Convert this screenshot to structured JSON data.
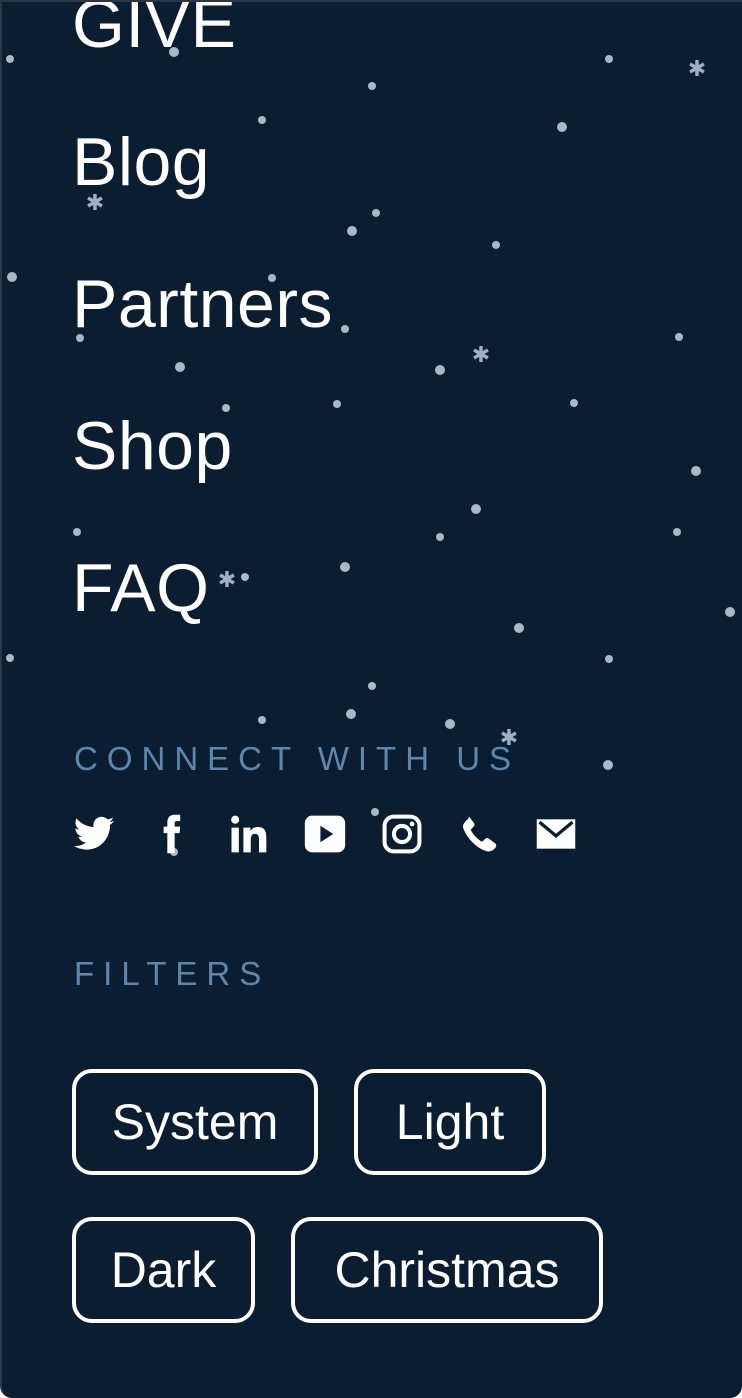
{
  "nav": {
    "items": [
      {
        "label": "GIVE"
      },
      {
        "label": "Blog"
      },
      {
        "label": "Partners"
      },
      {
        "label": "Shop"
      },
      {
        "label": "FAQ"
      }
    ]
  },
  "connect": {
    "heading": "CONNECT WITH US",
    "icons": [
      "twitter-icon",
      "facebook-icon",
      "linkedin-icon",
      "youtube-icon",
      "instagram-icon",
      "phone-icon",
      "email-icon"
    ]
  },
  "filters": {
    "heading": "FILTERS",
    "options": [
      {
        "label": "System"
      },
      {
        "label": "Light"
      },
      {
        "label": "Dark"
      },
      {
        "label": "Christmas"
      }
    ]
  },
  "colors": {
    "background": "#0b1d31",
    "heading": "#5f86ab",
    "text": "#ffffff"
  }
}
